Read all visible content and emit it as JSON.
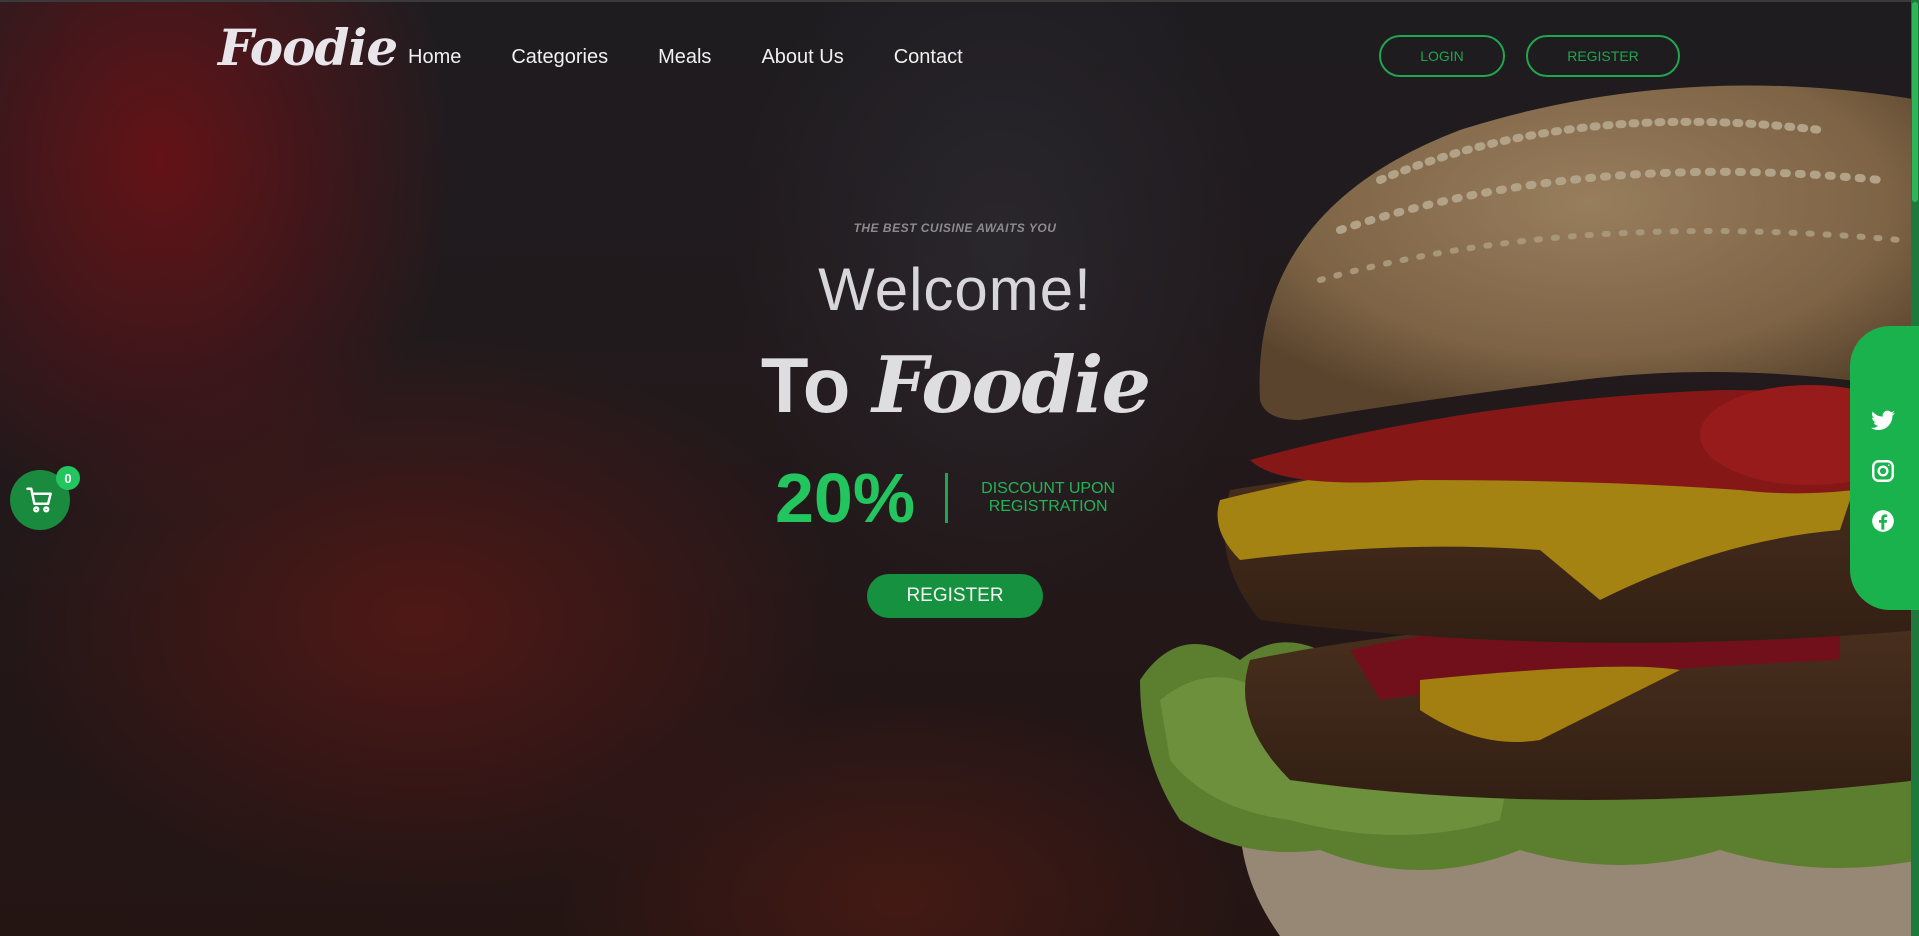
{
  "brand": {
    "logo_text": "Foodie"
  },
  "nav": {
    "items": [
      {
        "label": "Home"
      },
      {
        "label": "Categories"
      },
      {
        "label": "Meals"
      },
      {
        "label": "About Us"
      },
      {
        "label": "Contact"
      }
    ]
  },
  "auth": {
    "login_label": "LOGIN",
    "register_label": "REGISTER"
  },
  "hero": {
    "kicker": "THE BEST CUISINE AWAITS YOU",
    "welcome": "Welcome!",
    "to_word": "To",
    "brand_word": "Foodie",
    "discount_value": "20%",
    "discount_text": "DISCOUNT UPON REGISTRATION",
    "cta_label": "REGISTER"
  },
  "cart": {
    "count": "0",
    "icon": "shopping-cart-icon"
  },
  "social": {
    "icons": [
      "twitter-icon",
      "instagram-icon",
      "facebook-icon"
    ]
  },
  "colors": {
    "accent": "#22c55e",
    "accent_dark": "#16913f",
    "text_light": "#e8e6ea"
  }
}
